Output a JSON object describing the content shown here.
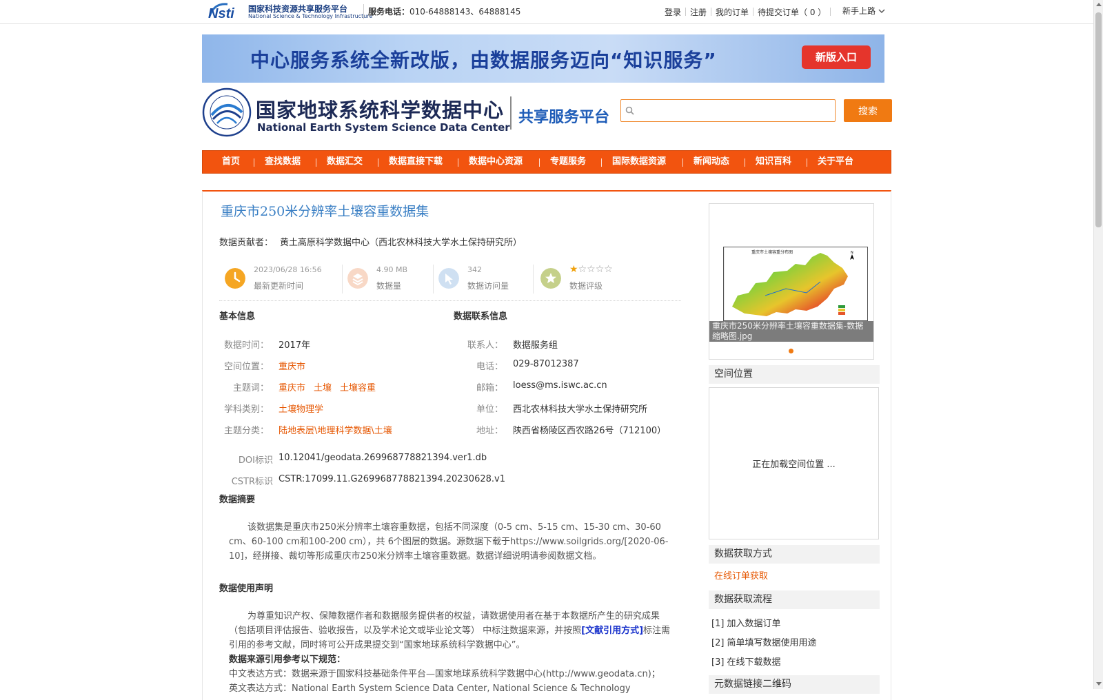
{
  "topbar": {
    "nsti_title_cn": "国家科技资源共享服务平台",
    "nsti_title_en": "National Science & Technology Infrastructure",
    "phone_label": "服务电话：",
    "phone_value": "010-64888143、64888145",
    "links": [
      "登录",
      "注册",
      "我的订单",
      "待提交订单（ 0 ）"
    ],
    "guide": "新手上路"
  },
  "banner": {
    "text": "中心服务系统全新改版，由数据服务迈向“知识服务”",
    "button": "新版入口"
  },
  "header": {
    "site_cn": "国家地球系统科学数据中心",
    "site_en": "National Earth System Science Data Center",
    "platform": "共享服务平台",
    "search_placeholder": "",
    "search_button": "搜索"
  },
  "nav": [
    "首页",
    "查找数据",
    "数据汇交",
    "数据直接下载",
    "数据中心资源",
    "专题服务",
    "国际数据资源",
    "新闻动态",
    "知识百科",
    "关于平台"
  ],
  "dataset": {
    "title": "重庆市250米分辨率土壤容重数据集",
    "contributor_label": "数据贡献者：",
    "contributor": "黄土高原科学数据中心（西北农林科技大学水土保持研究所）",
    "stats": [
      {
        "value": "2023/06/28 16:56",
        "label": "最新更新时间",
        "icon": "clock-icon"
      },
      {
        "value": "4.90 MB",
        "label": "数据量",
        "icon": "layers-icon"
      },
      {
        "value": "342",
        "label": "数据访问量",
        "icon": "cursor-icon"
      },
      {
        "label": "数据评级",
        "icon": "star-badge-icon",
        "rating": 1,
        "max_rating": 5
      }
    ],
    "basic_info_heading": "基本信息",
    "contact_heading": "数据联系信息",
    "basic": {
      "time_label": "数据时间：",
      "time": "2017年",
      "space_label": "空间位置：",
      "space": "重庆市",
      "keywords_label": "主题词：",
      "keywords": [
        "重庆市",
        "土壤",
        "土壤容重"
      ],
      "subject_label": "学科类别：",
      "subject": "土壤物理学",
      "category_label": "主题分类：",
      "category": "陆地表层\\地理科学数据\\土壤"
    },
    "contact": {
      "person_label": "联系人：",
      "person": "数据服务组",
      "tel_label": "电话：",
      "tel": "029-87012387",
      "email_label": "邮箱：",
      "email": "loess@ms.iswc.ac.cn",
      "unit_label": "单位：",
      "unit": "西北农林科技大学水土保持研究所",
      "address_label": "地址：",
      "address": "陕西省杨陵区西农路26号（712100）"
    },
    "doi_label": "DOI标识",
    "doi": "10.12041/geodata.269968778821394.ver1.db",
    "cstr_label": "CSTR标识",
    "cstr": "CSTR:17099.11.G269968778821394.20230628.v1",
    "abstract_heading": "数据摘要",
    "abstract": "该数据集是重庆市250米分辨率土壤容重数据，包括不同深度（0-5 cm、5-15 cm、15-30 cm、30-60 cm、60-100 cm和100-200 cm），共 6个图层的数据。源数据下载于https://www.soilgrids.org/[2020-06-10]，经拼接、裁切等形成重庆市250米分辨率土壤容重数据。数据详细说明请参阅数据文档。",
    "usage_heading": "数据使用声明",
    "usage_part1": "为尊重知识产权、保障数据作者和数据服务提供者的权益，请数据使用者在基于本数据所产生的研究成果（包括项目评估报告、验收报告，以及学术论文或毕业论文等） 中标注数据来源，并按照",
    "usage_cite": "[文献引用方式]",
    "usage_part2": "标注需引用的参考文献，同时将可公开成果提交到“国家地球系统科学数据中心”。",
    "source_heading": "数据来源引用参考以下规范：",
    "source_cn": "中文表达方式：数据来源于国家科技基础条件平台—国家地球系统科学数据中心(http://www.geodata.cn)；",
    "source_en": "英文表达方式：National Earth System Science Data Center, National Science & Technology"
  },
  "sidebar": {
    "thumb_caption": "重庆市250米分辨率土壤容重数据集-数据缩略图.jpg",
    "map_title": "重庆市土壤容重分布图",
    "spatial_heading": "空间位置",
    "spatial_loading": "正在加载空间位置 ...",
    "access_heading": "数据获取方式",
    "access_link": "在线订单获取",
    "process_heading": "数据获取流程",
    "steps": [
      "[1] 加入数据订单",
      "[2] 简单填写数据使用用途",
      "[3] 在线下载数据"
    ],
    "qr_heading": "元数据链接二维码"
  },
  "colors": {
    "brand_orange": "#f2540f",
    "link_orange": "#e65600",
    "title_blue": "#3a7fc4"
  }
}
